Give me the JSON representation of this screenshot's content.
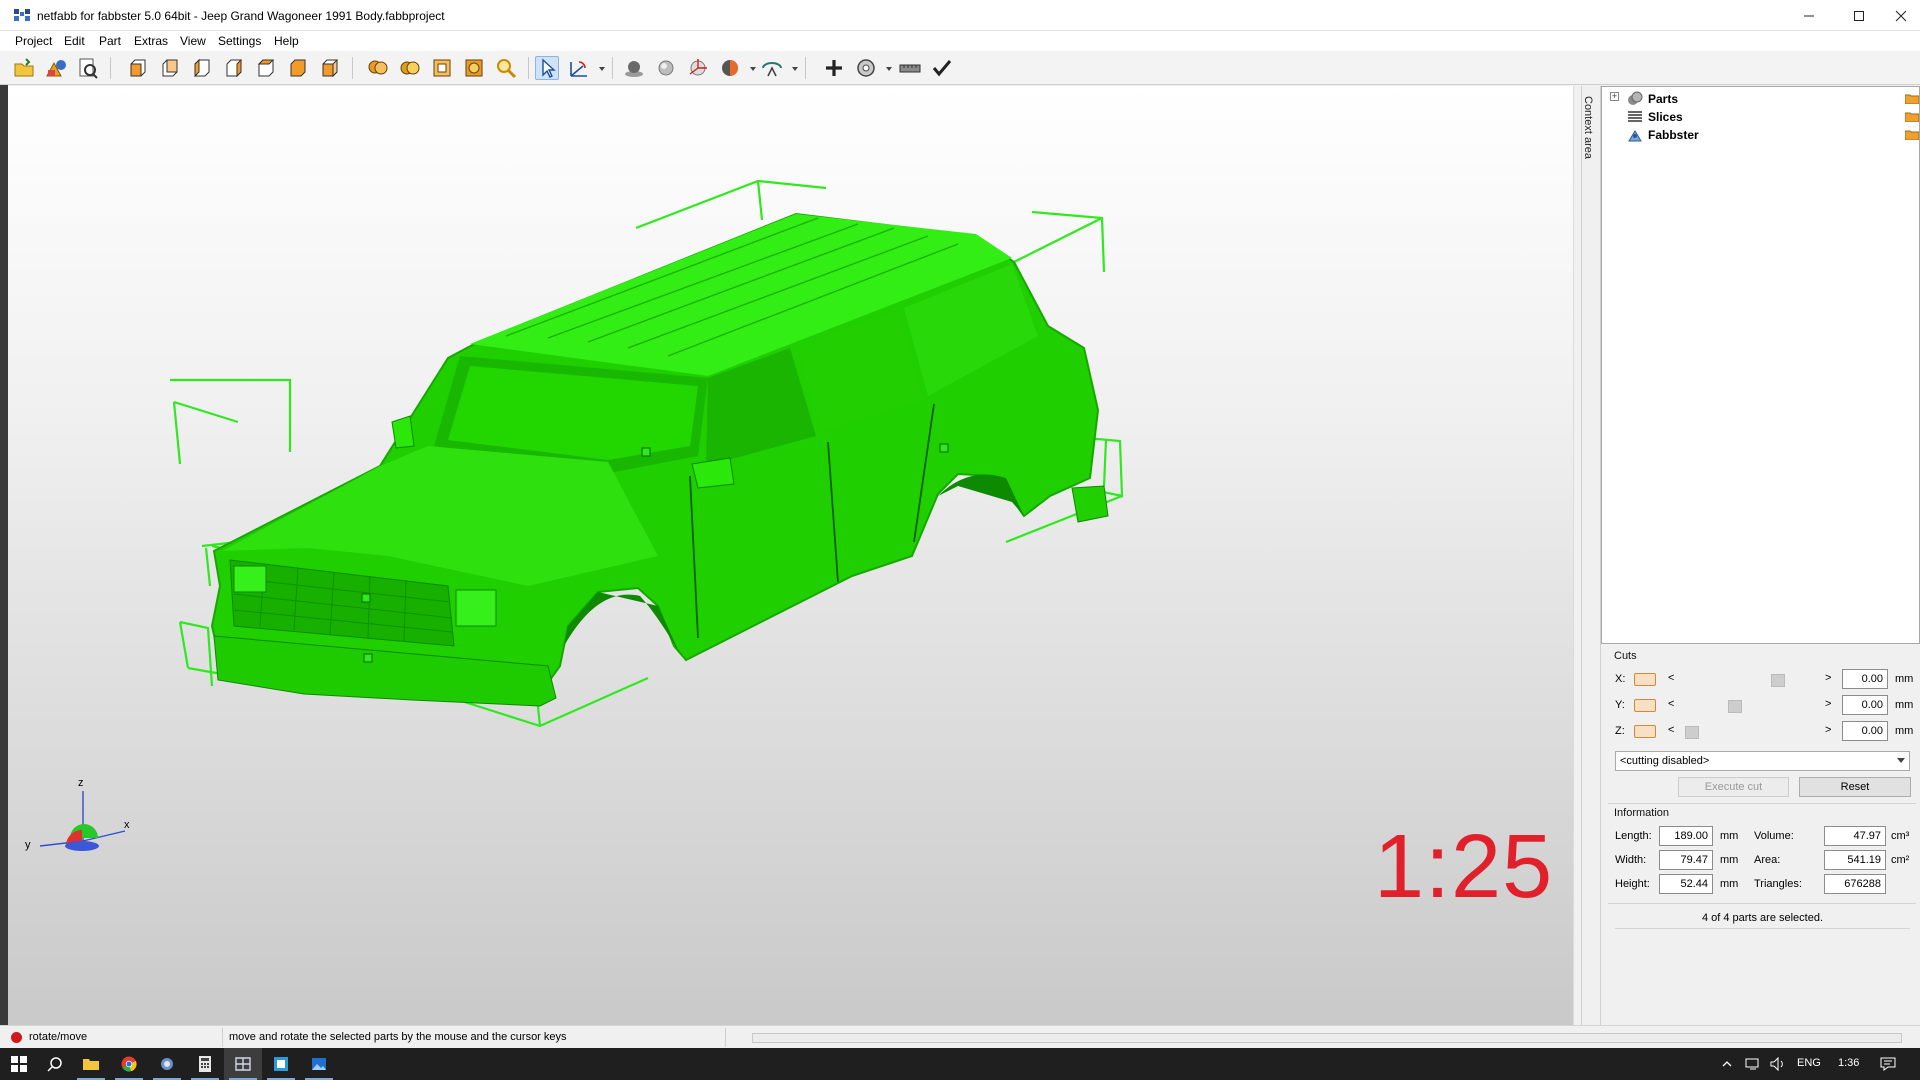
{
  "window": {
    "title": "netfabb for fabbster 5.0 64bit - Jeep Grand Wagoneer 1991 Body.fabbproject",
    "icon": "netfabb-app-icon",
    "controls": [
      "minimize-icon",
      "maximize-icon",
      "close-icon"
    ]
  },
  "menu": [
    "Project",
    "Edit",
    "Part",
    "Extras",
    "View",
    "Settings",
    "Help"
  ],
  "toolbar": {
    "tools": [
      "open-project-icon",
      "add-part-icon",
      "print-preview-icon",
      "view-front-icon",
      "view-back-icon",
      "view-left-icon",
      "view-right-icon",
      "view-top-icon",
      "view-bottom-icon",
      "view-iso-icon",
      "zoom-parts-icon",
      "zoom-selection-icon",
      "zoom-platform-icon",
      "zoom-all-icon",
      "zoom-glass-icon",
      "select-arrow-icon",
      "transform-axes-icon",
      "shading-icon",
      "smooth-shading-icon",
      "coordinates-icon",
      "color-mode-icon",
      "display-options-icon",
      "add-cross-icon",
      "rotate-gear-icon",
      "measure-ruler-icon",
      "apply-check-icon"
    ],
    "active_tool": "select-arrow-icon"
  },
  "viewport": {
    "scale_label": "1:25",
    "axis_labels": {
      "z": "z",
      "y": "y",
      "x": "x"
    },
    "model_color": "#22dd00",
    "bbox_color": "#2fe81e"
  },
  "side_tab": "Context area",
  "tree": {
    "items": [
      {
        "label": "Parts",
        "icon": "parts-icon"
      },
      {
        "label": "Slices",
        "icon": "slices-icon"
      },
      {
        "label": "Fabbster",
        "icon": "fabbster-icon"
      }
    ]
  },
  "cuts": {
    "title": "Cuts",
    "axes": [
      {
        "axis": "X:",
        "value": "0.00",
        "unit": "mm",
        "slider_pos": 0.95
      },
      {
        "axis": "Y:",
        "value": "0.00",
        "unit": "mm",
        "slider_pos": 0.5
      },
      {
        "axis": "Z:",
        "value": "0.00",
        "unit": "mm",
        "slider_pos": 0.05
      }
    ],
    "left_arrow": "<",
    "right_arrow": ">",
    "mode": "<cutting disabled>",
    "execute_label": "Execute cut",
    "reset_label": "Reset"
  },
  "information": {
    "title": "Information",
    "length_label": "Length:",
    "length": "189.00",
    "length_unit": "mm",
    "width_label": "Width:",
    "width": "79.47",
    "width_unit": "mm",
    "height_label": "Height:",
    "height": "52.44",
    "height_unit": "mm",
    "volume_label": "Volume:",
    "volume": "47.97",
    "volume_unit": "cm³",
    "area_label": "Area:",
    "area": "541.19",
    "area_unit": "cm²",
    "triangles_label": "Triangles:",
    "triangles": "676288",
    "selection_status": "4 of 4 parts are selected."
  },
  "statusbar": {
    "mode": "rotate/move",
    "hint": "move and rotate the selected parts by the mouse and the cursor keys"
  },
  "taskbar": {
    "apps": [
      "windows-start-icon",
      "search-icon",
      "file-explorer-icon",
      "chrome-icon",
      "netfabb-taskbar-icon",
      "calculator-icon",
      "grid-app-icon",
      "teams-app-icon",
      "photo-app-icon"
    ],
    "tray": {
      "language": "ENG",
      "time": "1:36"
    }
  }
}
